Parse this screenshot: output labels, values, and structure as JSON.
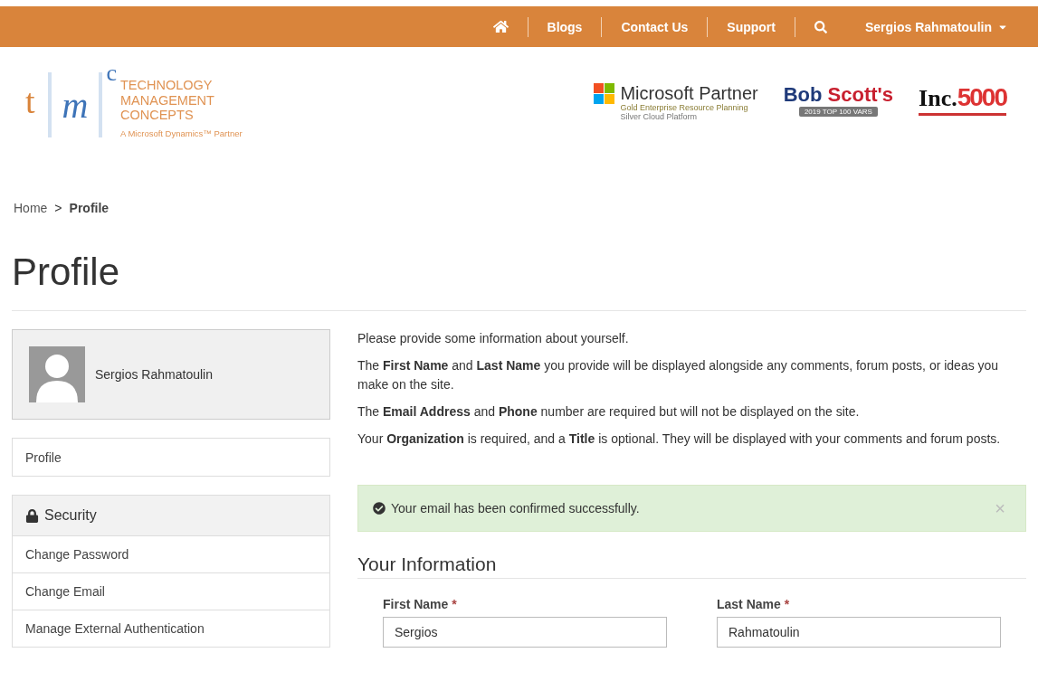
{
  "nav": {
    "links": [
      {
        "kind": "home"
      },
      {
        "kind": "link",
        "label": "Blogs"
      },
      {
        "kind": "link",
        "label": "Contact Us"
      },
      {
        "kind": "link",
        "label": "Support"
      },
      {
        "kind": "search"
      },
      {
        "kind": "user",
        "label": "Sergios Rahmatoulin"
      }
    ]
  },
  "logo": {
    "t": "t",
    "m": "m",
    "c": "c",
    "lines": [
      "TECHNOLOGY",
      "MANAGEMENT",
      "CONCEPTS"
    ],
    "tagline": "A Microsoft Dynamics™ Partner"
  },
  "partners": {
    "microsoft": {
      "name": "Microsoft Partner",
      "gold": "Gold Enterprise Resource Planning",
      "silver": "Silver Cloud Platform"
    },
    "bobscott": {
      "first": "Bob",
      "second": "Scott's",
      "banner": "2019 TOP 100 VARS"
    },
    "inc": {
      "name": "Inc.",
      "number": "5000"
    }
  },
  "breadcrumb": [
    {
      "label": "Home",
      "current": false
    },
    {
      "label": "Profile",
      "current": true
    }
  ],
  "breadcrumb_separator": ">",
  "page_title": "Profile",
  "user_card": {
    "name": "Sergios Rahmatoulin"
  },
  "side_nav": [
    {
      "label": "Profile",
      "selected": false
    }
  ],
  "security": {
    "title": "Security",
    "items": [
      {
        "label": "Change Password"
      },
      {
        "label": "Change Email"
      },
      {
        "label": "Manage External Authentication"
      }
    ]
  },
  "intro": [
    "Please provide some information about yourself.",
    "The **First Name** and **Last Name** you provide will be displayed alongside any comments, forum posts, or ideas you make on the site.",
    "The **Email Address** and **Phone** number are required but will not be displayed on the site.",
    "Your **Organization** is required, and a **Title** is optional. They will be displayed with your comments and forum posts."
  ],
  "alert": {
    "message": "Your email has been confirmed successfully.",
    "close": "×"
  },
  "section_title": "Your Information",
  "fields": [
    {
      "label": "First Name",
      "required_mark": "*",
      "value": "Sergios"
    },
    {
      "label": "Last Name",
      "required_mark": "*",
      "value": "Rahmatoulin"
    }
  ]
}
